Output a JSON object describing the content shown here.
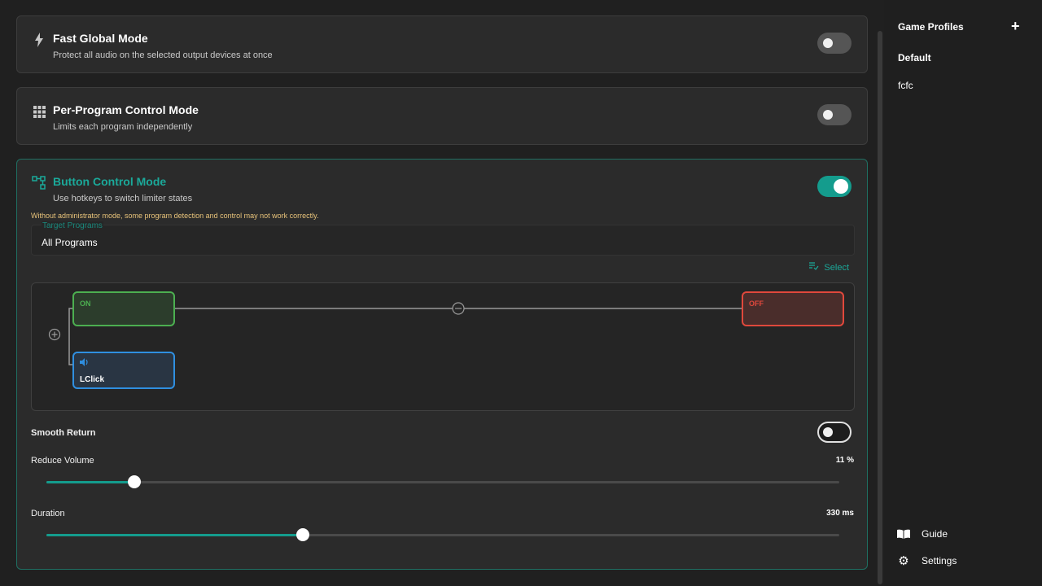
{
  "modes": {
    "fast_global": {
      "title": "Fast Global Mode",
      "subtitle": "Protect all audio on the selected output devices at once",
      "icon": "lightning-icon",
      "enabled": false
    },
    "per_program": {
      "title": "Per-Program Control Mode",
      "subtitle": "Limits each program independently",
      "icon": "grid-icon",
      "enabled": false
    },
    "button_control": {
      "title": "Button Control Mode",
      "subtitle": "Use hotkeys to switch limiter states",
      "icon": "flow-icon",
      "enabled": true,
      "warning": "Without administrator mode, some program detection and control may not work correctly.",
      "target_label": "Target Programs",
      "target_value": "All Programs",
      "select_label": "Select",
      "diagram": {
        "on_label": "ON",
        "off_label": "OFF",
        "key_label": "LClick",
        "key_icon": "speaker-icon"
      },
      "smooth_return": {
        "label": "Smooth Return",
        "enabled": false
      },
      "reduce_volume": {
        "label": "Reduce Volume",
        "value_text": "11 %",
        "fraction": 0.111
      },
      "duration": {
        "label": "Duration",
        "value_text": "330 ms",
        "fraction": 0.323
      }
    }
  },
  "sidebar": {
    "title": "Game Profiles",
    "add_icon": "plus-icon",
    "profiles": [
      "Default",
      "fcfc"
    ],
    "guide_label": "Guide",
    "settings_label": "Settings"
  },
  "colors": {
    "accent": "#149c8d",
    "on_node": "#4caf50",
    "off_node": "#e0483c",
    "key_node": "#2f8fe0",
    "warning": "#e8c37a"
  }
}
